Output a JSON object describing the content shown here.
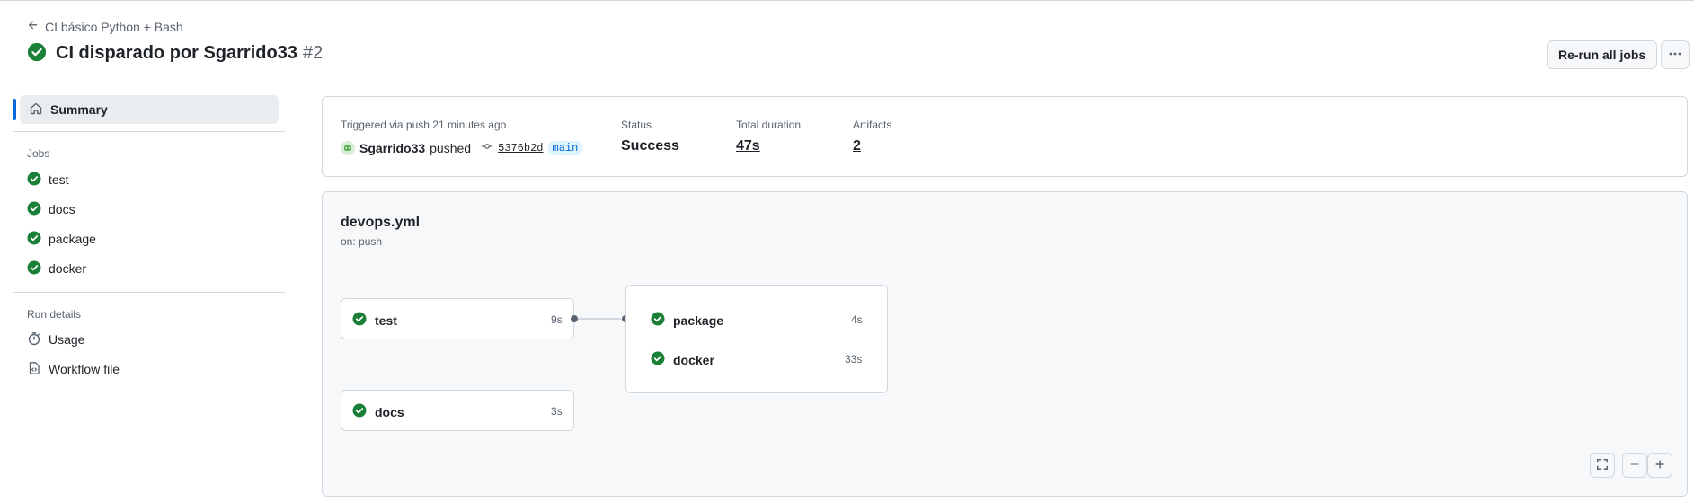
{
  "header": {
    "back_label": "CI básico Python + Bash",
    "title": "CI disparado por Sgarrido33",
    "run_number": "#2",
    "rerun_label": "Re-run all jobs"
  },
  "sidebar": {
    "summary_label": "Summary",
    "jobs_heading": "Jobs",
    "jobs": [
      "test",
      "docs",
      "package",
      "docker"
    ],
    "run_details_heading": "Run details",
    "usage_label": "Usage",
    "workflow_file_label": "Workflow file"
  },
  "summary": {
    "trigger_text": "Triggered via push 21 minutes ago",
    "actor": "Sgarrido33",
    "action": "pushed",
    "commit": "5376b2d",
    "branch": "main",
    "status_label": "Status",
    "status_value": "Success",
    "duration_label": "Total duration",
    "duration_value": "47s",
    "artifacts_label": "Artifacts",
    "artifacts_value": "2"
  },
  "workflow": {
    "file": "devops.yml",
    "trigger": "on: push",
    "jobs": {
      "test": {
        "name": "test",
        "duration": "9s"
      },
      "docs": {
        "name": "docs",
        "duration": "3s"
      },
      "package": {
        "name": "package",
        "duration": "4s"
      },
      "docker": {
        "name": "docker",
        "duration": "33s"
      }
    }
  },
  "colors": {
    "success": "#1a7f37",
    "accent": "#0969da"
  },
  "icons": [
    "arrow-left-icon",
    "check-circle-icon",
    "kebab-horizontal-icon",
    "home-icon",
    "stopwatch-icon",
    "file-code-icon",
    "git-commit-icon",
    "fullscreen-icon",
    "zoom-out-icon",
    "zoom-in-icon"
  ]
}
